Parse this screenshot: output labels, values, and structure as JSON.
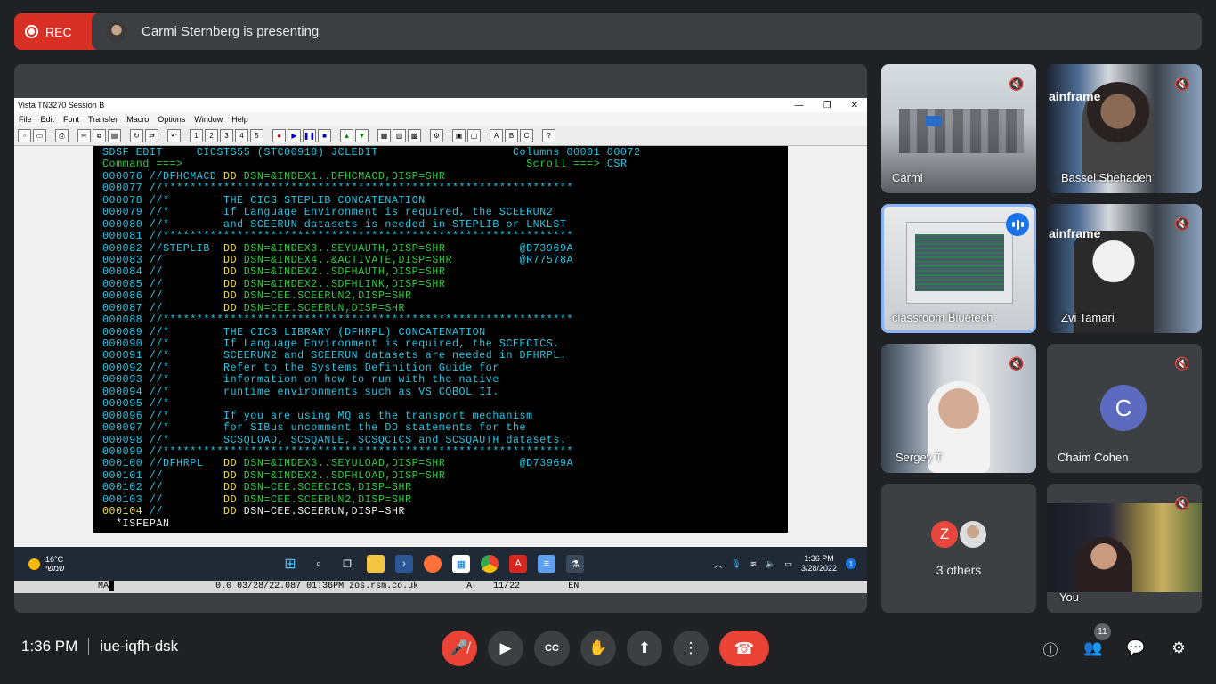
{
  "recording": {
    "label": "REC"
  },
  "presenter": {
    "text": "Carmi Sternberg is presenting"
  },
  "window": {
    "title": "Vista TN3270 Session B",
    "menu": [
      "File",
      "Edit",
      "Font",
      "Transfer",
      "Macro",
      "Options",
      "Window",
      "Help"
    ]
  },
  "terminal_lines": [
    [
      {
        "t": "SDSF EDIT     CICSTS55 (STC00918) JCLEDIT                    Columns 00001 00072",
        "c": "c-c"
      }
    ],
    [
      {
        "t": "Command ===> ",
        "c": "c-g"
      },
      {
        "t": "                                                  Scroll ===> ",
        "c": "c-g"
      },
      {
        "t": "CSR",
        "c": "c-c"
      }
    ],
    [
      {
        "t": "000076 ",
        "c": "c-c"
      },
      {
        "t": "//DFHCMACD ",
        "c": "c-c"
      },
      {
        "t": "DD ",
        "c": "c-y"
      },
      {
        "t": "DSN=&INDEX1..DFHCMACD,DISP=SHR",
        "c": "c-g"
      }
    ],
    [
      {
        "t": "000077 ",
        "c": "c-c"
      },
      {
        "t": "//*************************************************************",
        "c": "c-c"
      }
    ],
    [
      {
        "t": "000078 ",
        "c": "c-c"
      },
      {
        "t": "//*        THE CICS STEPLIB CONCATENATION",
        "c": "c-c"
      }
    ],
    [
      {
        "t": "000079 ",
        "c": "c-c"
      },
      {
        "t": "//*        If Language Environment is required, the SCEERUN2",
        "c": "c-c"
      }
    ],
    [
      {
        "t": "000080 ",
        "c": "c-c"
      },
      {
        "t": "//*        and SCEERUN datasets is needed in STEPLIB or LNKLST",
        "c": "c-c"
      }
    ],
    [
      {
        "t": "000081 ",
        "c": "c-c"
      },
      {
        "t": "//*************************************************************",
        "c": "c-c"
      }
    ],
    [
      {
        "t": "000082 ",
        "c": "c-c"
      },
      {
        "t": "//STEPLIB  ",
        "c": "c-c"
      },
      {
        "t": "DD ",
        "c": "c-y"
      },
      {
        "t": "DSN=&INDEX3..SEYUAUTH,DISP=SHR           ",
        "c": "c-g"
      },
      {
        "t": "@D73969A",
        "c": "c-c"
      }
    ],
    [
      {
        "t": "000083 ",
        "c": "c-c"
      },
      {
        "t": "//         ",
        "c": "c-c"
      },
      {
        "t": "DD ",
        "c": "c-y"
      },
      {
        "t": "DSN=&INDEX4..&ACTIVATE,DISP=SHR          ",
        "c": "c-g"
      },
      {
        "t": "@R77578A",
        "c": "c-c"
      }
    ],
    [
      {
        "t": "000084 ",
        "c": "c-c"
      },
      {
        "t": "//         ",
        "c": "c-c"
      },
      {
        "t": "DD ",
        "c": "c-y"
      },
      {
        "t": "DSN=&INDEX2..SDFHAUTH,DISP=SHR",
        "c": "c-g"
      }
    ],
    [
      {
        "t": "000085 ",
        "c": "c-c"
      },
      {
        "t": "//         ",
        "c": "c-c"
      },
      {
        "t": "DD ",
        "c": "c-y"
      },
      {
        "t": "DSN=&INDEX2..SDFHLINK,DISP=SHR",
        "c": "c-g"
      }
    ],
    [
      {
        "t": "000086 ",
        "c": "c-c"
      },
      {
        "t": "//         ",
        "c": "c-c"
      },
      {
        "t": "DD ",
        "c": "c-y"
      },
      {
        "t": "DSN=CEE.SCEERUN2,DISP=SHR",
        "c": "c-g"
      }
    ],
    [
      {
        "t": "000087 ",
        "c": "c-c"
      },
      {
        "t": "//         ",
        "c": "c-c"
      },
      {
        "t": "DD ",
        "c": "c-y"
      },
      {
        "t": "DSN=CEE.SCEERUN,DISP=SHR",
        "c": "c-g"
      }
    ],
    [
      {
        "t": "000088 ",
        "c": "c-c"
      },
      {
        "t": "//*************************************************************",
        "c": "c-c"
      }
    ],
    [
      {
        "t": "000089 ",
        "c": "c-c"
      },
      {
        "t": "//*        THE CICS LIBRARY (DFHRPL) CONCATENATION",
        "c": "c-c"
      }
    ],
    [
      {
        "t": "000090 ",
        "c": "c-c"
      },
      {
        "t": "//*        If Language Environment is required, the SCEECICS,",
        "c": "c-c"
      }
    ],
    [
      {
        "t": "000091 ",
        "c": "c-c"
      },
      {
        "t": "//*        SCEERUN2 and SCEERUN datasets are needed in DFHRPL.",
        "c": "c-c"
      }
    ],
    [
      {
        "t": "000092 ",
        "c": "c-c"
      },
      {
        "t": "//*        Refer to the Systems Definition Guide for",
        "c": "c-c"
      }
    ],
    [
      {
        "t": "000093 ",
        "c": "c-c"
      },
      {
        "t": "//*        information on how to run with the native",
        "c": "c-c"
      }
    ],
    [
      {
        "t": "000094 ",
        "c": "c-c"
      },
      {
        "t": "//*        runtime environments such as VS COBOL II.",
        "c": "c-c"
      }
    ],
    [
      {
        "t": "000095 ",
        "c": "c-c"
      },
      {
        "t": "//*",
        "c": "c-c"
      }
    ],
    [
      {
        "t": "000096 ",
        "c": "c-c"
      },
      {
        "t": "//*        If you are using MQ as the transport mechanism",
        "c": "c-c"
      }
    ],
    [
      {
        "t": "000097 ",
        "c": "c-c"
      },
      {
        "t": "//*        for SIBus uncomment the DD statements for the",
        "c": "c-c"
      }
    ],
    [
      {
        "t": "000098 ",
        "c": "c-c"
      },
      {
        "t": "//*        SCSQLOAD, SCSQANLE, SCSQCICS and SCSQAUTH datasets.",
        "c": "c-c"
      }
    ],
    [
      {
        "t": "000099 ",
        "c": "c-c"
      },
      {
        "t": "//*************************************************************",
        "c": "c-c"
      }
    ],
    [
      {
        "t": "000100 ",
        "c": "c-c"
      },
      {
        "t": "//DFHRPL   ",
        "c": "c-c"
      },
      {
        "t": "DD ",
        "c": "c-y"
      },
      {
        "t": "DSN=&INDEX3..SEYULOAD,DISP=SHR           ",
        "c": "c-g"
      },
      {
        "t": "@D73969A",
        "c": "c-c"
      }
    ],
    [
      {
        "t": "000101 ",
        "c": "c-c"
      },
      {
        "t": "//         ",
        "c": "c-c"
      },
      {
        "t": "DD ",
        "c": "c-y"
      },
      {
        "t": "DSN=&INDEX2..SDFHLOAD,DISP=SHR",
        "c": "c-g"
      }
    ],
    [
      {
        "t": "000102 ",
        "c": "c-c"
      },
      {
        "t": "//         ",
        "c": "c-c"
      },
      {
        "t": "DD ",
        "c": "c-y"
      },
      {
        "t": "DSN=CEE.SCEECICS,DISP=SHR",
        "c": "c-g"
      }
    ],
    [
      {
        "t": "000103 ",
        "c": "c-c"
      },
      {
        "t": "//         ",
        "c": "c-c"
      },
      {
        "t": "DD ",
        "c": "c-y"
      },
      {
        "t": "DSN=CEE.SCEERUN2,DISP=SHR",
        "c": "c-g"
      }
    ],
    [
      {
        "t": "000104 ",
        "c": "c-y"
      },
      {
        "t": "//         ",
        "c": "c-c"
      },
      {
        "t": "DD ",
        "c": "c-y"
      },
      {
        "t": "DSN=CEE.SCEERUN,DISP=SHR",
        "c": "c-w"
      }
    ],
    [
      {
        "t": "  *ISFEPAN",
        "c": "c-w"
      }
    ]
  ],
  "statusline": {
    "mode": "MA",
    "info": "0.0 03/28/22.087 01:36PM zos.rsm.co.uk",
    "flag": "A",
    "pos": "11/22",
    "lang": "EN"
  },
  "taskbar": {
    "temp": "16°C",
    "weather_text": "שמשי",
    "time": "1:36 PM",
    "date": "3/28/2022",
    "notif": "1"
  },
  "participants": [
    {
      "name": "Carmi",
      "muted": true
    },
    {
      "name": "Bassel Shehadeh",
      "muted": true,
      "overlay": "ainframe"
    },
    {
      "name": "classroom Bluetech",
      "speaking": true
    },
    {
      "name": "Zvi Tamari",
      "muted": true,
      "overlay": "ainframe"
    },
    {
      "name": "Sergey T",
      "muted": true
    },
    {
      "name": "Chaim Cohen",
      "muted": true,
      "initial": "C"
    },
    {
      "name": "3 others",
      "initial": "Z"
    },
    {
      "name": "You",
      "muted": true
    }
  ],
  "footer": {
    "time": "1:36 PM",
    "code": "iue-iqfh-dsk",
    "people_count": "11"
  }
}
